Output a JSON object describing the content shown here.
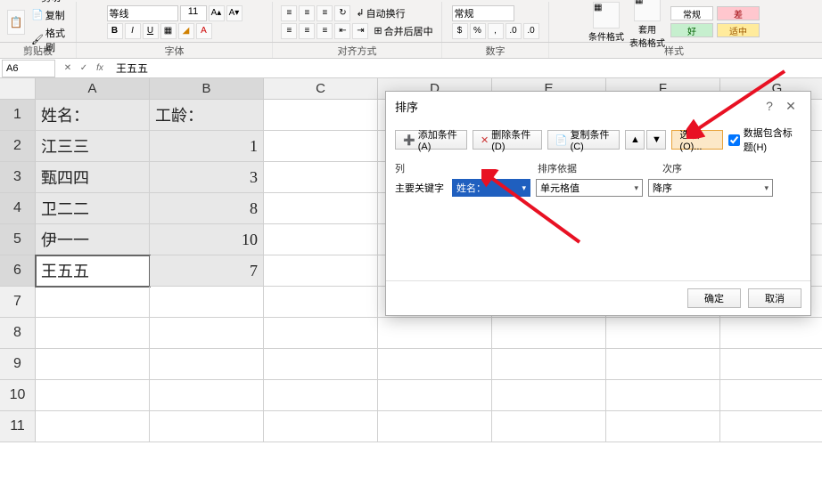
{
  "ribbon": {
    "clipboard": {
      "cut": "剪切",
      "copy": "复制",
      "format_painter": "格式刷",
      "group": "剪贴板"
    },
    "font": {
      "name": "等线",
      "size": "11",
      "bold": "B",
      "italic": "I",
      "underline": "U",
      "group": "字体"
    },
    "alignment": {
      "wrap": "自动换行",
      "merge": "合并后居中",
      "group": "对齐方式"
    },
    "number": {
      "format": "常规",
      "group": "数字"
    },
    "styles": {
      "conditional": "条件格式",
      "table_format": "套用\n表格格式",
      "s1": "常规",
      "s2": "差",
      "s3": "好",
      "s4": "适中",
      "group": "样式"
    }
  },
  "formula_bar": {
    "cell_ref": "A6",
    "fx": "fx",
    "value": "王五五"
  },
  "sheet": {
    "columns": [
      "A",
      "B",
      "C",
      "D",
      "E",
      "F",
      "G"
    ],
    "rows": [
      "1",
      "2",
      "3",
      "4",
      "5",
      "6",
      "7",
      "8",
      "9",
      "10",
      "11"
    ],
    "data": {
      "A1": "姓名：",
      "B1": "工龄：",
      "A2": "江三三",
      "B2": "1",
      "A3": "甄四四",
      "B3": "3",
      "A4": "卫二二",
      "B4": "8",
      "A5": "伊一一",
      "B5": "10",
      "A6": "王五五",
      "B6": "7"
    }
  },
  "dialog": {
    "title": "排序",
    "add": "添加条件(A)",
    "del": "删除条件(D)",
    "copy": "复制条件(C)",
    "options": "选项(O)...",
    "header_check": "数据包含标题(H)",
    "col_header": "列",
    "by_header": "排序依据",
    "order_header": "次序",
    "key_label": "主要关键字",
    "key_value": "姓名：",
    "by_value": "单元格值",
    "order_value": "降序",
    "ok": "确定",
    "cancel": "取消"
  },
  "chart_data": null
}
